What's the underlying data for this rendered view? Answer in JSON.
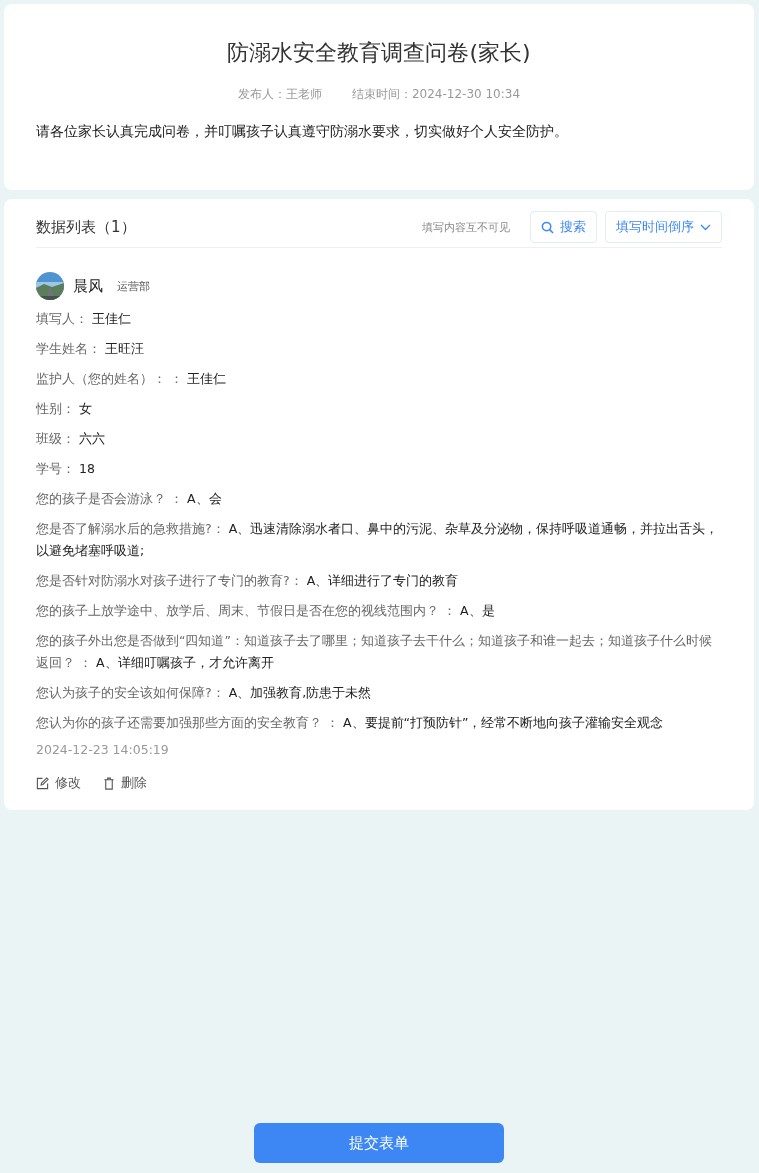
{
  "survey": {
    "title": "防溺水安全教育调查问卷(家长)",
    "publisher": "发布人：王老师",
    "end_time": "结束时间：2024-12-30 10:34",
    "description": "请各位家长认真完成问卷，并叮嘱孩子认真遵守防溺水要求，切实做好个人安全防护。"
  },
  "list": {
    "title": "数据列表（1）",
    "visibility_note": "填写内容互不可见",
    "search_button": "搜索",
    "sort_button": "填写时间倒序"
  },
  "entry": {
    "user_name": "晨风",
    "department": "运营部",
    "fields": [
      {
        "label": "填写人：",
        "value": "王佳仁"
      },
      {
        "label": "学生姓名：",
        "value": "王旺汪"
      },
      {
        "label": "监护人（您的姓名）： ：",
        "value": "王佳仁"
      },
      {
        "label": "性别：",
        "value": "女"
      },
      {
        "label": "班级：",
        "value": "六六"
      },
      {
        "label": "学号：",
        "value": "18"
      },
      {
        "label": "您的孩子是否会游泳？ ：",
        "value": "A、会"
      },
      {
        "label": "您是否了解溺水后的急救措施?：",
        "value": "A、迅速清除溺水者口、鼻中的污泥、杂草及分泌物，保持呼吸道通畅，并拉出舌头，以避免堵塞呼吸道;"
      },
      {
        "label": "您是否针对防溺水对孩子进行了专门的教育?：",
        "value": "A、详细进行了专门的教育"
      },
      {
        "label": "您的孩子上放学途中、放学后、周末、节假日是否在您的视线范围内？ ：",
        "value": "A、是"
      },
      {
        "label": "您的孩子外出您是否做到“四知道”：知道孩子去了哪里；知道孩子去干什么；知道孩子和谁一起去；知道孩子什么时候返回？ ：",
        "value": "A、详细叮嘱孩子，才允许离开"
      },
      {
        "label": "您认为孩子的安全该如何保障?：",
        "value": "A、加强教育,防患于未然"
      },
      {
        "label": "您认为你的孩子还需要加强那些方面的安全教育？ ：",
        "value": "A、要提前“打预防针”，经常不断地向孩子灌输安全观念"
      }
    ],
    "submitted_at": "2024-12-23 14:05:19",
    "edit_button": "修改",
    "delete_button": "删除"
  },
  "submit_button": "提交表单"
}
